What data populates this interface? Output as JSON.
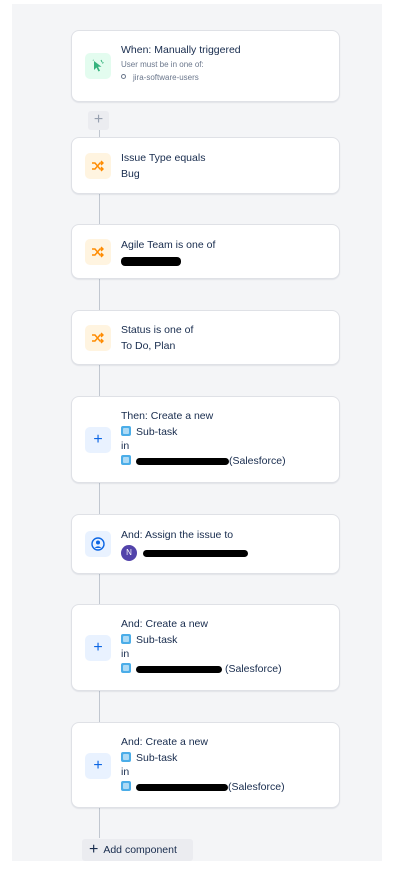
{
  "trigger": {
    "title": "When: Manually triggered",
    "note": "User must be in one of:",
    "group": "jira-software-users",
    "icon": "cursor-click-icon"
  },
  "conditions": [
    {
      "line1": "Issue Type equals",
      "line2": "Bug",
      "icon": "branch-icon"
    },
    {
      "line1": "Agile Team is one of",
      "line2": "",
      "icon": "branch-icon"
    },
    {
      "line1": "Status is one of",
      "line2": "To Do, Plan",
      "icon": "branch-icon"
    }
  ],
  "actions": [
    {
      "title": "Then: Create a new",
      "type": "Sub-task",
      "in": "in",
      "project_suffix": "(Salesforce)",
      "icon": "plus-icon"
    },
    {
      "title": "And: Assign the issue to",
      "avatar_initial": "N",
      "icon": "person-circle-icon"
    },
    {
      "title": "And: Create a new",
      "type": "Sub-task",
      "in": "in",
      "project_suffix": "(Salesforce)",
      "icon": "plus-icon"
    },
    {
      "title": "And: Create a new",
      "type": "Sub-task",
      "in": "in",
      "project_suffix": "(Salesforce)",
      "icon": "plus-icon"
    }
  ],
  "add_component": {
    "label": "Add component"
  },
  "colors": {
    "trigger_icon": "#36b37e",
    "condition_icon": "#ff8b00",
    "action_icon": "#0c66e4",
    "avatar": "#5243aa"
  }
}
